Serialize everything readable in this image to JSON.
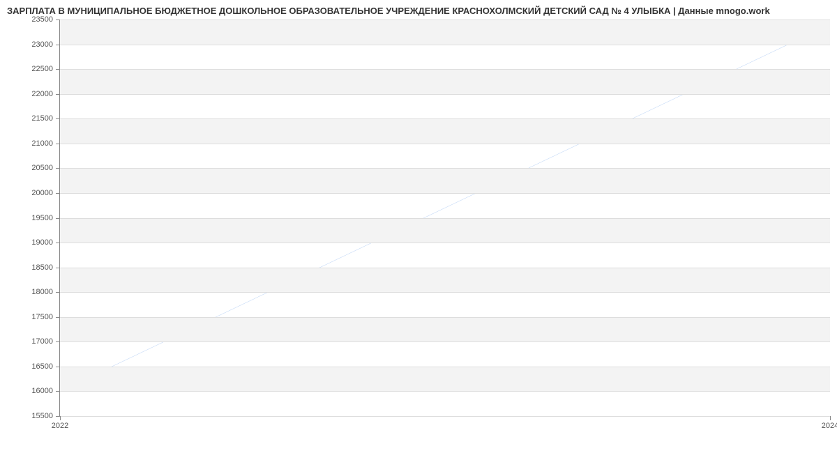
{
  "chart_data": {
    "type": "line",
    "title": "ЗАРПЛАТА В МУНИЦИПАЛЬНОЕ БЮДЖЕТНОЕ ДОШКОЛЬНОЕ ОБРАЗОВАТЕЛЬНОЕ УЧРЕЖДЕНИЕ КРАСНОХОЛМСКИЙ ДЕТСКИЙ САД № 4 УЛЫБКА | Данные mnogo.work",
    "x": [
      2022,
      2024
    ],
    "values": [
      16000,
      23400
    ],
    "xlabel": "",
    "ylabel": "",
    "xlim": [
      2022,
      2024
    ],
    "ylim": [
      15500,
      23500
    ],
    "yticks": [
      15500,
      16000,
      16500,
      17000,
      17500,
      18000,
      18500,
      19000,
      19500,
      20000,
      20500,
      21000,
      21500,
      22000,
      22500,
      23000,
      23500
    ],
    "xticks": [
      2022,
      2024
    ],
    "line_color": "#6a9ee8"
  }
}
